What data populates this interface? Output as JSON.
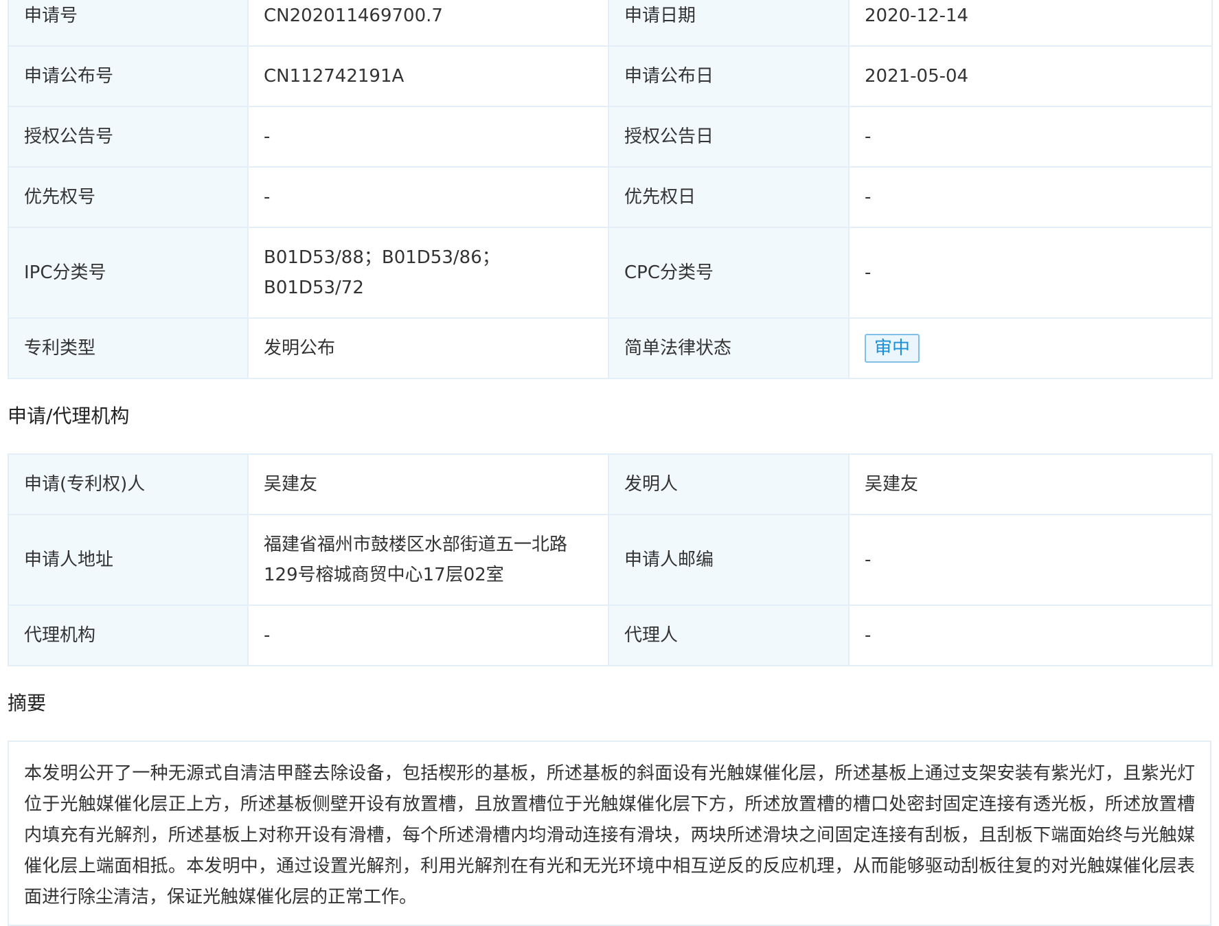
{
  "basic_info": {
    "rows": [
      {
        "l1": "申请号",
        "v1": "CN202011469700.7",
        "l2": "申请日期",
        "v2": "2020-12-14"
      },
      {
        "l1": "申请公布号",
        "v1": "CN112742191A",
        "l2": "申请公布日",
        "v2": "2021-05-04"
      },
      {
        "l1": "授权公告号",
        "v1": "-",
        "l2": "授权公告日",
        "v2": "-"
      },
      {
        "l1": "优先权号",
        "v1": "-",
        "l2": "优先权日",
        "v2": "-"
      },
      {
        "l1": "IPC分类号",
        "v1": "B01D53/88；B01D53/86；B01D53/72",
        "l2": "CPC分类号",
        "v2": "-"
      },
      {
        "l1": "专利类型",
        "v1": "发明公布",
        "l2": "简单法律状态",
        "v2": "审中"
      }
    ]
  },
  "agency_section": {
    "title": "申请/代理机构",
    "rows": [
      {
        "l1": "申请(专利权)人",
        "v1": "吴建友",
        "l2": "发明人",
        "v2": "吴建友"
      },
      {
        "l1": "申请人地址",
        "v1": "福建省福州市鼓楼区水部街道五一北路129号榕城商贸中心17层02室",
        "l2": "申请人邮编",
        "v2": "-"
      },
      {
        "l1": "代理机构",
        "v1": "-",
        "l2": "代理人",
        "v2": "-"
      }
    ]
  },
  "abstract_section": {
    "title": "摘要",
    "text": "本发明公开了一种无源式自清洁甲醛去除设备，包括楔形的基板，所述基板的斜面设有光触媒催化层，所述基板上通过支架安装有紫光灯，且紫光灯位于光触媒催化层正上方，所述基板侧壁开设有放置槽，且放置槽位于光触媒催化层下方，所述放置槽的槽口处密封固定连接有透光板，所述放置槽内填充有光解剂，所述基板上对称开设有滑槽，每个所述滑槽内均滑动连接有滑块，两块所述滑块之间固定连接有刮板，且刮板下端面始终与光触媒催化层上端面相抵。本发明中，通过设置光解剂，利用光解剂在有光和无光环境中相互逆反的反应机理，从而能够驱动刮板往复的对光触媒催化层表面进行除尘清洁，保证光触媒催化层的正常工作。"
  }
}
